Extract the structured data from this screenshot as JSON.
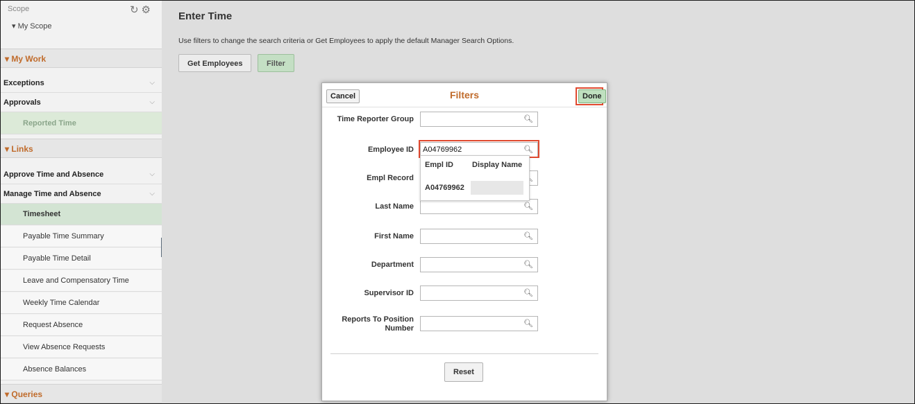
{
  "sidebar": {
    "scope_title": "Scope",
    "scope_item": "My Scope",
    "sections": {
      "my_work": "My Work",
      "links": "Links",
      "queries": "Queries"
    },
    "my_work_items": [
      {
        "label": "Exceptions"
      },
      {
        "label": "Approvals"
      }
    ],
    "approvals_sub": "Reported Time",
    "links_items": [
      {
        "label": "Approve Time and Absence"
      },
      {
        "label": "Manage Time and Absence"
      }
    ],
    "manage_sub": [
      {
        "label": "Timesheet"
      },
      {
        "label": "Payable Time Summary"
      },
      {
        "label": "Payable Time Detail"
      },
      {
        "label": "Leave and Compensatory Time"
      },
      {
        "label": "Weekly Time Calendar"
      },
      {
        "label": "Request Absence"
      },
      {
        "label": "View Absence Requests"
      },
      {
        "label": "Absence Balances"
      }
    ]
  },
  "main": {
    "title": "Enter Time",
    "instructions": "Use filters to change the search criteria or Get Employees to apply the default Manager Search Options.",
    "get_employees_label": "Get Employees",
    "filter_label": "Filter"
  },
  "modal": {
    "title": "Filters",
    "cancel_label": "Cancel",
    "done_label": "Done",
    "fields": {
      "time_reporter_group": {
        "label": "Time Reporter Group",
        "value": ""
      },
      "employee_id": {
        "label": "Employee ID",
        "value": "A04769962"
      },
      "empl_record": {
        "label": "Empl Record",
        "value": ""
      },
      "last_name": {
        "label": "Last Name",
        "value": ""
      },
      "first_name": {
        "label": "First Name",
        "value": ""
      },
      "department": {
        "label": "Department",
        "value": ""
      },
      "supervisor_id": {
        "label": "Supervisor ID",
        "value": ""
      },
      "reports_to_line1": "Reports To Position",
      "reports_to_line2": "Number",
      "reports_to_value": ""
    },
    "dropdown": {
      "col_id": "Empl ID",
      "col_name": "Display Name",
      "row_id": "A04769962"
    },
    "reset_label": "Reset"
  },
  "icons": {
    "refresh": "refresh-icon",
    "settings": "gear-icon",
    "search": "magnifier-icon"
  },
  "colors": {
    "accent": "#c06b2b",
    "highlight": "#e0492f",
    "green_button": "#c4dfc4"
  }
}
